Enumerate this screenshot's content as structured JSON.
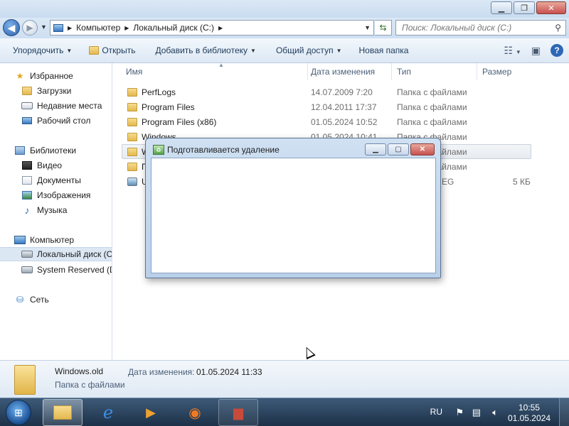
{
  "explorer": {
    "address": {
      "crumbs": [
        "Компьютер",
        "Локальный диск (C:)"
      ]
    },
    "search": {
      "placeholder": "Поиск: Локальный диск (C:)"
    },
    "toolbar": {
      "organize": "Упорядочить",
      "open": "Открыть",
      "add_to_library": "Добавить в библиотеку",
      "share": "Общий доступ",
      "new_folder": "Новая папка"
    },
    "nav": {
      "favorites": "Избранное",
      "downloads": "Загрузки",
      "recent": "Недавние места",
      "desktop": "Рабочий стол",
      "libraries": "Библиотеки",
      "video": "Видео",
      "documents": "Документы",
      "images": "Изображения",
      "music": "Музыка",
      "computer": "Компьютер",
      "local_disk": "Локальный диск (C",
      "system_reserved": "System Reserved (D:",
      "network": "Сеть"
    },
    "columns": {
      "name": "Имя",
      "date": "Дата изменения",
      "type": "Тип",
      "size": "Размер"
    },
    "rows": [
      {
        "name": "PerfLogs",
        "date": "14.07.2009 7:20",
        "type": "Папка с файлами",
        "size": ""
      },
      {
        "name": "Program Files",
        "date": "12.04.2011 17:37",
        "type": "Папка с файлами",
        "size": ""
      },
      {
        "name": "Program Files (x86)",
        "date": "01.05.2024 10:52",
        "type": "Папка с файлами",
        "size": ""
      },
      {
        "name": "Windows",
        "date": "01.05.2024 10:41",
        "type": "Папка с файлами",
        "size": ""
      },
      {
        "name": "W",
        "date": "",
        "type": "Папка с файлами",
        "size": ""
      },
      {
        "name": "П",
        "date": "",
        "type": "Папка с файлами",
        "size": ""
      },
      {
        "name": "U",
        "date": "",
        "type": "EG",
        "size": "5 КБ"
      }
    ],
    "details": {
      "name": "Windows.old",
      "date_label": "Дата изменения:",
      "date": "01.05.2024 11:33",
      "type": "Папка с файлами"
    }
  },
  "dialog": {
    "title": "Подготавливается удаление"
  },
  "taskbar": {
    "language": "RU",
    "time": "10:55",
    "date": "01.05.2024"
  }
}
